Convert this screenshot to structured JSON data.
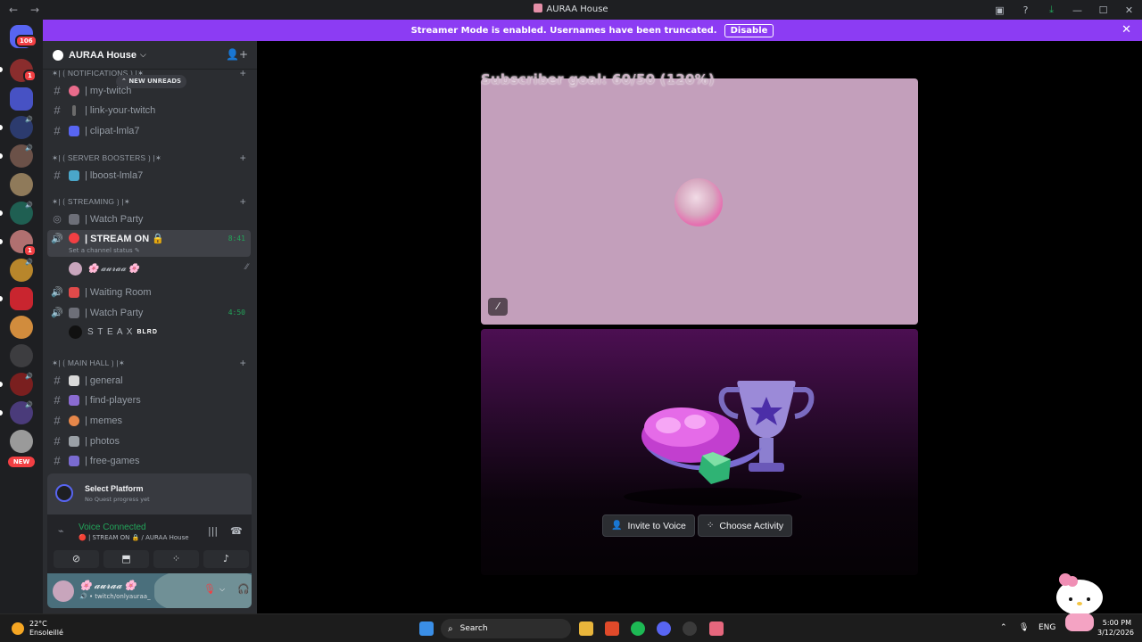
{
  "window": {
    "title": "AURAA House",
    "back": "←",
    "forward": "→"
  },
  "banner": {
    "text": "Streamer Mode is enabled. Usernames have been truncated.",
    "disable_label": "Disable",
    "close": "✕"
  },
  "rail": {
    "notifications_badge": "106",
    "badge_1": "1",
    "badge_2": "1",
    "new_label": "NEW"
  },
  "server": {
    "name": "AURAA House"
  },
  "new_unreads": "NEW UNREADS",
  "categories": {
    "notifications": "✶| ⟮ NOTIFICATIONS ⟯ |✶",
    "boosters": "✶| ⟮ SERVER BOOSTERS ⟯ |✶",
    "streaming": "✶| ⟮ STREAMING ⟯ |✶",
    "main_hall": "✶| ⟮ MAIN HALL ⟯ |✶"
  },
  "channels": {
    "my_twitch": "| my-twitch",
    "link_your_twitch": "| link-your-twitch",
    "clipat": "| clipat-lmla7",
    "boost": "| lboost-lmla7",
    "watch_party_stage": "| Watch Party",
    "stream_on": "| STREAM ON 🔒",
    "stream_on_time": "8:41",
    "channel_status": "Set a channel status",
    "user_auraa": "🌸 𝓪𝓾𝓻𝓪𝓪 🌸",
    "waiting_room": "| Waiting Room",
    "watch_party": "| Watch Party",
    "watch_party_time": "4:50",
    "user_steax": "S T E A X",
    "steax_tag": "BLRD",
    "general": "| general",
    "find_players": "| find-players",
    "memes": "| memes",
    "photos": "| photos",
    "free_games": "| free-games"
  },
  "quest": {
    "title": "Select Platform",
    "subtitle": "No Quest progress yet"
  },
  "voice": {
    "title": "Voice Connected",
    "subtitle": "| STREAM ON 🔒 / AURAA House"
  },
  "user": {
    "name": "🌸 𝓪𝓾𝓻𝓪𝓪 🌸",
    "status": "twitch/onlyauraa_"
  },
  "stage": {
    "goal": "Subscriber goal: 60/50 (120%)",
    "invite_label": "Invite to Voice",
    "activity_label": "Choose Activity"
  },
  "taskbar": {
    "temp": "22°C",
    "weather": "Ensoleillé",
    "search": "Search",
    "lang": "ENG",
    "time": "5:00 PM",
    "date": "3/12/2026"
  },
  "colors": {
    "accent": "#8c3cf3",
    "voice_green": "#23a55a",
    "stage_tile": "#c39fbb"
  }
}
